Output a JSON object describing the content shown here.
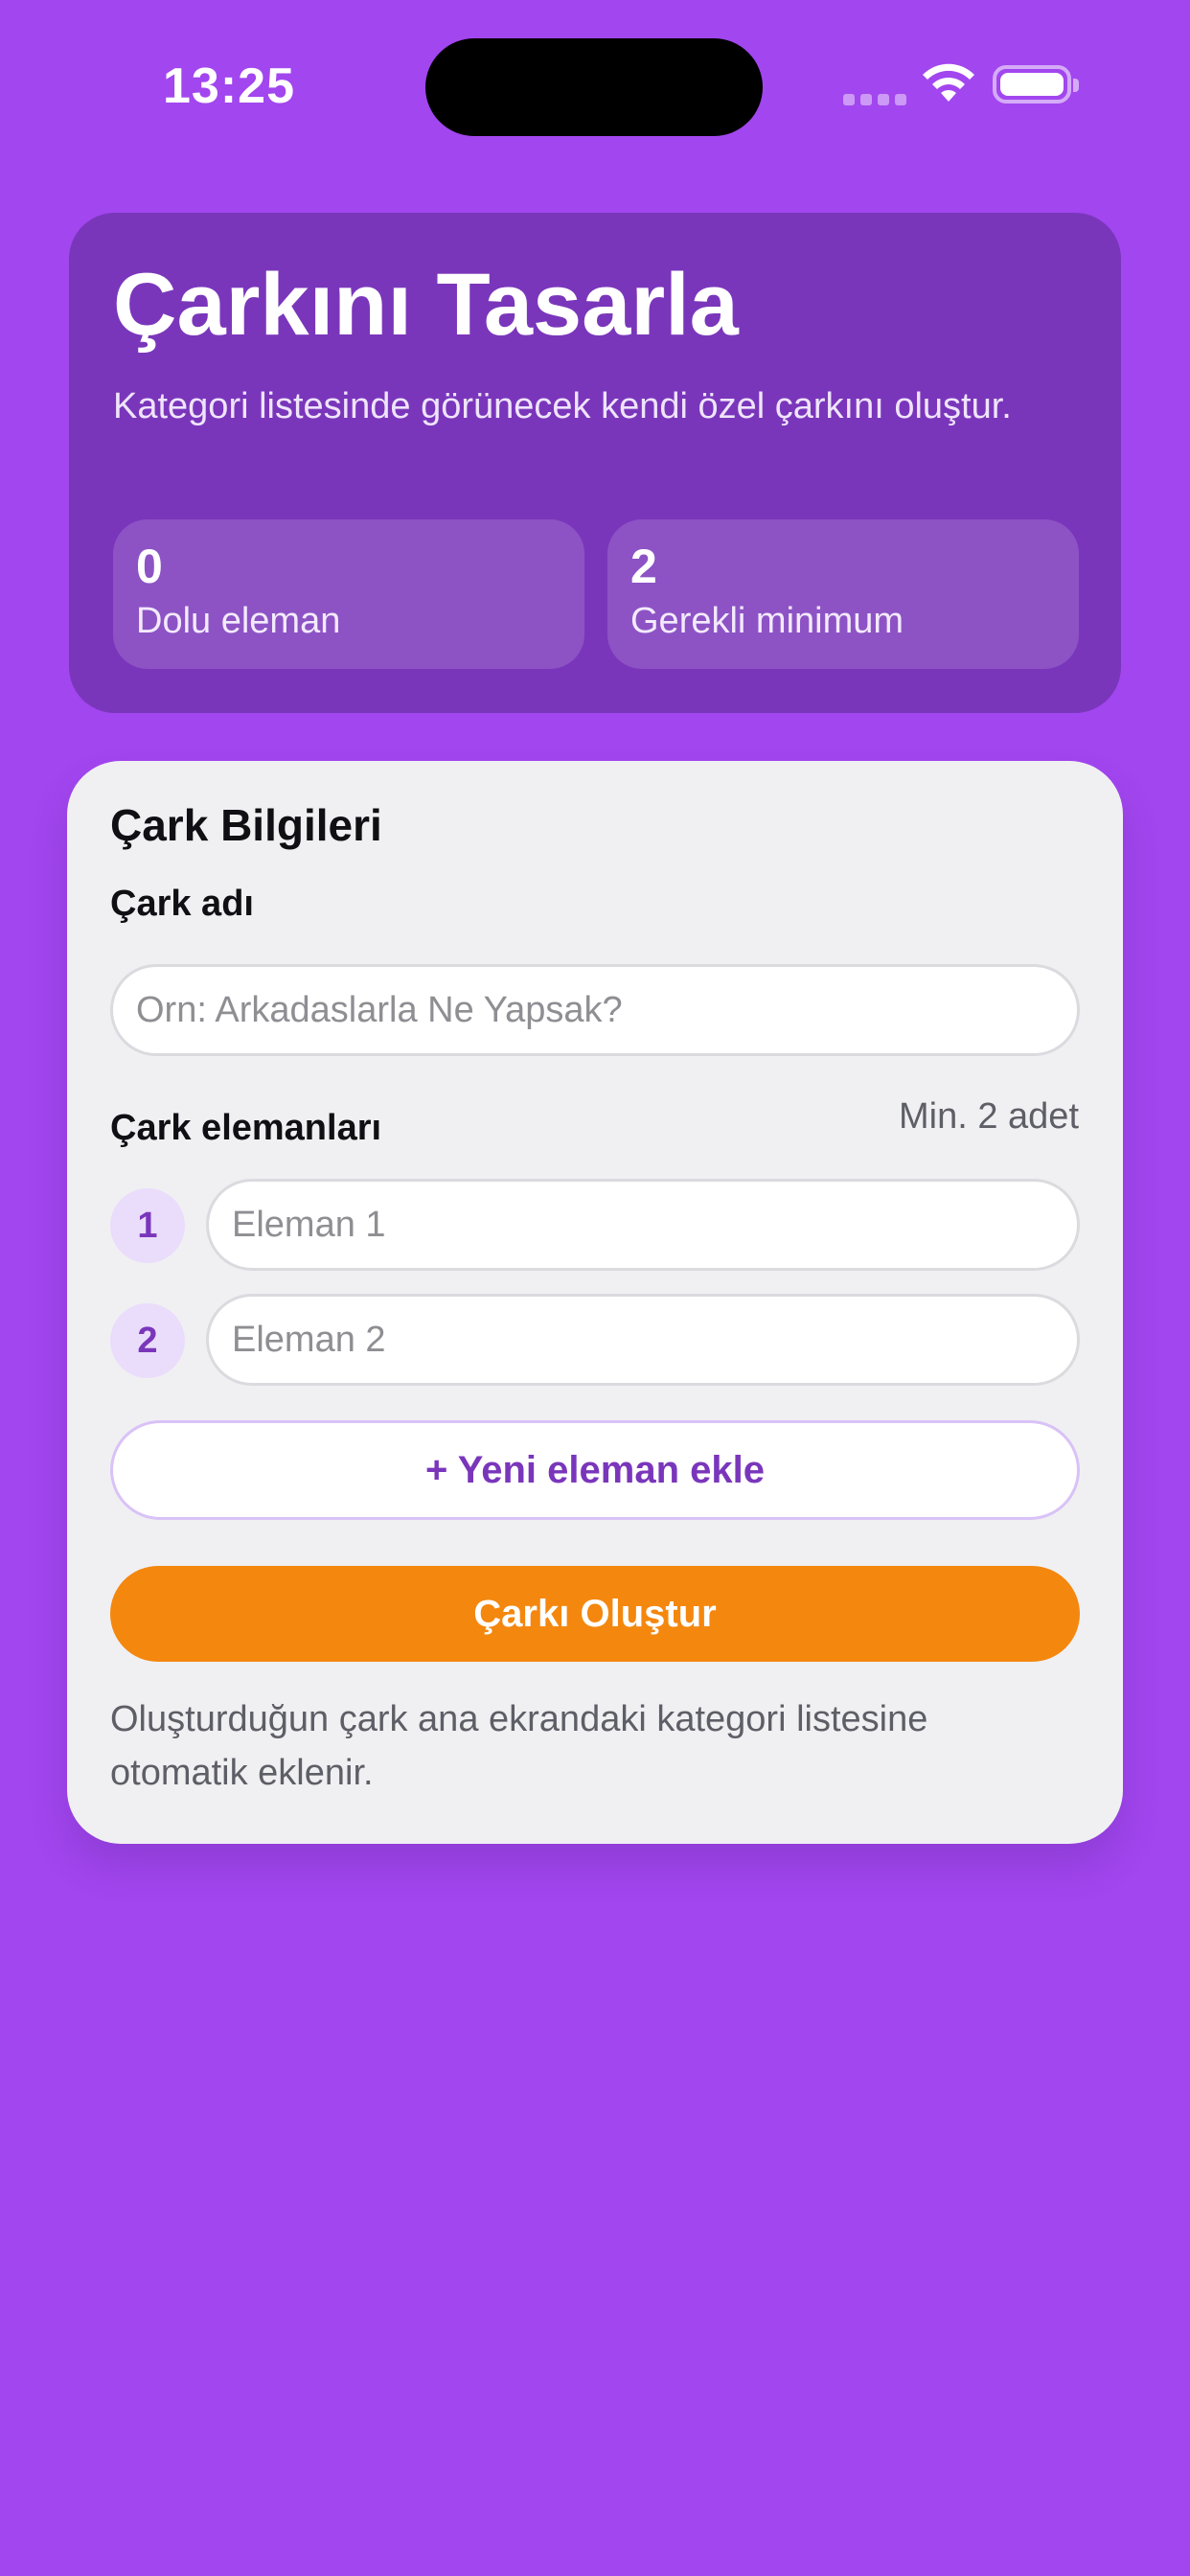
{
  "status_bar": {
    "time": "13:25"
  },
  "hero": {
    "title": "Çarkını Tasarla",
    "subtitle": "Kategori listesinde görünecek kendi özel çarkını oluştur.",
    "stats": [
      {
        "value": "0",
        "label": "Dolu eleman"
      },
      {
        "value": "2",
        "label": "Gerekli minimum"
      }
    ]
  },
  "form": {
    "section_title": "Çark Bilgileri",
    "name_label": "Çark adı",
    "name_placeholder": "Orn: Arkadaslarla Ne Yapsak?",
    "name_value": "",
    "items_label": "Çark elemanları",
    "min_note": "Min. 2 adet",
    "items": [
      {
        "index": "1",
        "placeholder": "Eleman 1",
        "value": ""
      },
      {
        "index": "2",
        "placeholder": "Eleman 2",
        "value": ""
      }
    ],
    "add_button_label": "+ Yeni eleman ekle",
    "create_button_label": "Çarkı Oluştur",
    "footnote": "Oluşturduğun çark ana ekrandaki kategori listesine otomatik eklenir."
  },
  "colors": {
    "background": "#A246EF",
    "hero_card": "#7A36BB",
    "accent_orange": "#F4870E",
    "accent_purple": "#7A36BB"
  }
}
